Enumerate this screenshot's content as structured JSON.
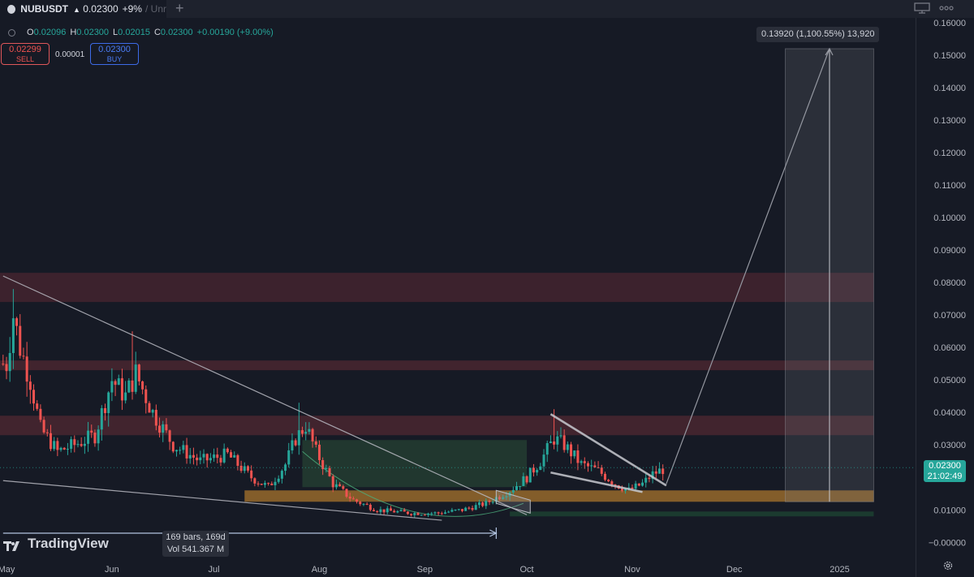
{
  "header": {
    "symbol": "NUBUSDT",
    "arrow": "▲",
    "price": "0.02300",
    "change": "+9%",
    "extra": "/ Unr",
    "plus": "+"
  },
  "legend": {
    "o_label": "O",
    "o_value": "0.02096",
    "h_label": "H",
    "h_value": "0.02300",
    "l_label": "L",
    "l_value": "0.02015",
    "c_label": "C",
    "c_value": "0.02300",
    "change": "+0.00190 (+9.00%)"
  },
  "trade": {
    "sell_price": "0.02299",
    "sell_label": "SELL",
    "buy_price": "0.02300",
    "buy_label": "BUY",
    "spread": "0.00001"
  },
  "measure_label": "0.13920 (1,100.55%) 13,920",
  "range_info": {
    "bars": "169 bars, 169d",
    "volume": "Vol 541.367 M"
  },
  "price_tag": {
    "price": "0.02300",
    "countdown": "21:02:49"
  },
  "brand": "TradingView",
  "icons": [
    "circle-logo-icon",
    "monitor-icon",
    "more-dots-icon",
    "settings-gear-icon"
  ],
  "colors": {
    "up": "#26a69a",
    "down": "#ef5350",
    "background": "#161a25",
    "resistance_zone": "#6b2d38",
    "support_zone": "#f0a030"
  },
  "chart_data": {
    "type": "candlestick",
    "x_labels": [
      "May",
      "Jun",
      "Jul",
      "Aug",
      "Sep",
      "Oct",
      "Nov",
      "Dec",
      "2025"
    ],
    "y_ticks": [
      "0.16000",
      "0.15000",
      "0.14000",
      "0.13000",
      "0.12000",
      "0.11000",
      "0.10000",
      "0.09000",
      "0.08000",
      "0.07000",
      "0.06000",
      "0.05000",
      "0.04000",
      "0.03000",
      "0.02000",
      "0.01000",
      "−0.00000"
    ],
    "ylim": [
      0,
      0.16
    ],
    "current_price": 0.023,
    "price_path": [
      [
        "2024-05-01",
        0.055
      ],
      [
        "2024-05-03",
        0.07
      ],
      [
        "2024-05-05",
        0.06
      ],
      [
        "2024-05-08",
        0.05
      ],
      [
        "2024-05-11",
        0.035
      ],
      [
        "2024-05-16",
        0.028
      ],
      [
        "2024-05-21",
        0.03
      ],
      [
        "2024-05-27",
        0.033
      ],
      [
        "2024-06-01",
        0.05
      ],
      [
        "2024-06-05",
        0.045
      ],
      [
        "2024-06-08",
        0.052
      ],
      [
        "2024-06-13",
        0.04
      ],
      [
        "2024-06-19",
        0.03
      ],
      [
        "2024-06-27",
        0.025
      ],
      [
        "2024-07-05",
        0.027
      ],
      [
        "2024-07-12",
        0.02
      ],
      [
        "2024-07-17",
        0.017
      ],
      [
        "2024-07-22",
        0.024
      ],
      [
        "2024-07-25",
        0.032
      ],
      [
        "2024-07-28",
        0.036
      ],
      [
        "2024-07-31",
        0.028
      ],
      [
        "2024-08-05",
        0.018
      ],
      [
        "2024-08-11",
        0.013
      ],
      [
        "2024-08-18",
        0.01
      ],
      [
        "2024-08-28",
        0.009
      ],
      [
        "2024-09-05",
        0.009
      ],
      [
        "2024-09-12",
        0.01
      ],
      [
        "2024-09-19",
        0.012
      ],
      [
        "2024-09-26",
        0.016
      ],
      [
        "2024-10-01",
        0.02
      ],
      [
        "2024-10-05",
        0.025
      ],
      [
        "2024-10-09",
        0.032
      ],
      [
        "2024-10-12",
        0.03
      ],
      [
        "2024-10-17",
        0.024
      ],
      [
        "2024-10-22",
        0.022
      ],
      [
        "2024-10-27",
        0.018
      ],
      [
        "2024-10-31",
        0.016
      ],
      [
        "2024-11-04",
        0.018
      ],
      [
        "2024-11-07",
        0.021
      ],
      [
        "2024-11-11",
        0.023
      ]
    ],
    "wick_highs": [
      [
        "2024-05-03",
        0.078
      ],
      [
        "2024-06-07",
        0.065
      ],
      [
        "2024-07-26",
        0.043
      ],
      [
        "2024-10-09",
        0.041
      ]
    ],
    "zones": [
      {
        "low": 0.074,
        "high": 0.083
      },
      {
        "low": 0.053,
        "high": 0.056
      },
      {
        "low": 0.033,
        "high": 0.039
      },
      {
        "low": 0.0125,
        "high": 0.016
      },
      {
        "low": 0.008,
        "high": 0.0095
      }
    ],
    "projection": {
      "from": [
        "2024-11-11",
        0.018
      ],
      "to": [
        "2024-12-29",
        0.152
      ]
    },
    "measure_box": {
      "x_start": "2024-12-16",
      "x_end": "2025-01-11",
      "low": 0.0125,
      "high": 0.152
    },
    "consolidation_box": {
      "x_start": "2024-07-27",
      "x_end": "2024-10-01",
      "low": 0.017,
      "high": 0.0315
    },
    "trendlines": [
      {
        "from": [
          "2024-04-30",
          0.082
        ],
        "to": [
          "2024-10-01",
          0.0085
        ]
      },
      {
        "from": [
          "2024-04-30",
          0.019
        ],
        "to": [
          "2024-09-06",
          0.0068
        ]
      },
      {
        "from": [
          "2024-10-08",
          0.0395
        ],
        "to": [
          "2024-11-11",
          0.0175
        ]
      },
      {
        "from": [
          "2024-10-08",
          0.0215
        ],
        "to": [
          "2024-11-04",
          0.0155
        ]
      }
    ],
    "date_range": {
      "x_start": "2024-04-30",
      "x_end": "2024-09-22"
    }
  }
}
